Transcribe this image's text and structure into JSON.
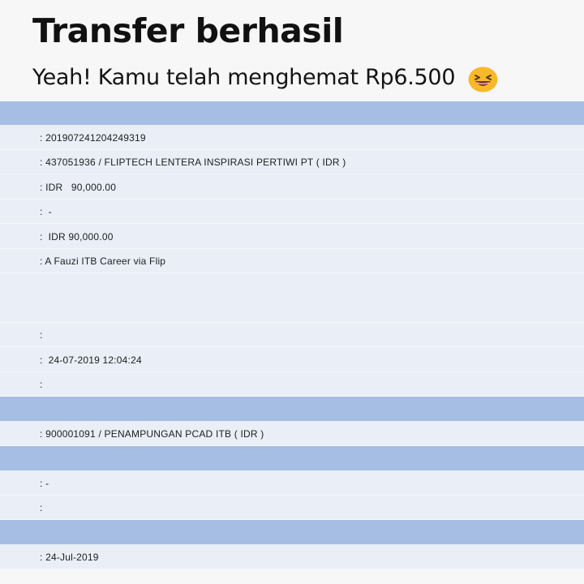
{
  "header": {
    "title": "Transfer berhasil",
    "subtitle": "Yeah! Kamu telah menghemat Rp6.500",
    "emoji": "grinning-squinting-face-icon"
  },
  "receipt": {
    "reference": ": 201907241204249319",
    "from_account": ": 437051936 / FLIPTECH LENTERA INSPIRASI PERTIWI PT ( IDR )",
    "amount": ": IDR   90,000.00",
    "fee": ":  -",
    "total": ":  IDR 90,000.00",
    "remark": ": A Fauzi ITB Career via Flip",
    "blank_1": ":",
    "datetime": ":  24-07-2019 12:04:24",
    "blank_2": ":",
    "to_account": ": 900001091 / PENAMPUNGAN PCAD ITB ( IDR )",
    "dash": ": -",
    "blank_3": ":",
    "date": ": 24-Jul-2019"
  },
  "colors": {
    "section_band": "#a6bee3",
    "row_bg": "#e9eef7",
    "emoji_face": "#f7b82b"
  }
}
